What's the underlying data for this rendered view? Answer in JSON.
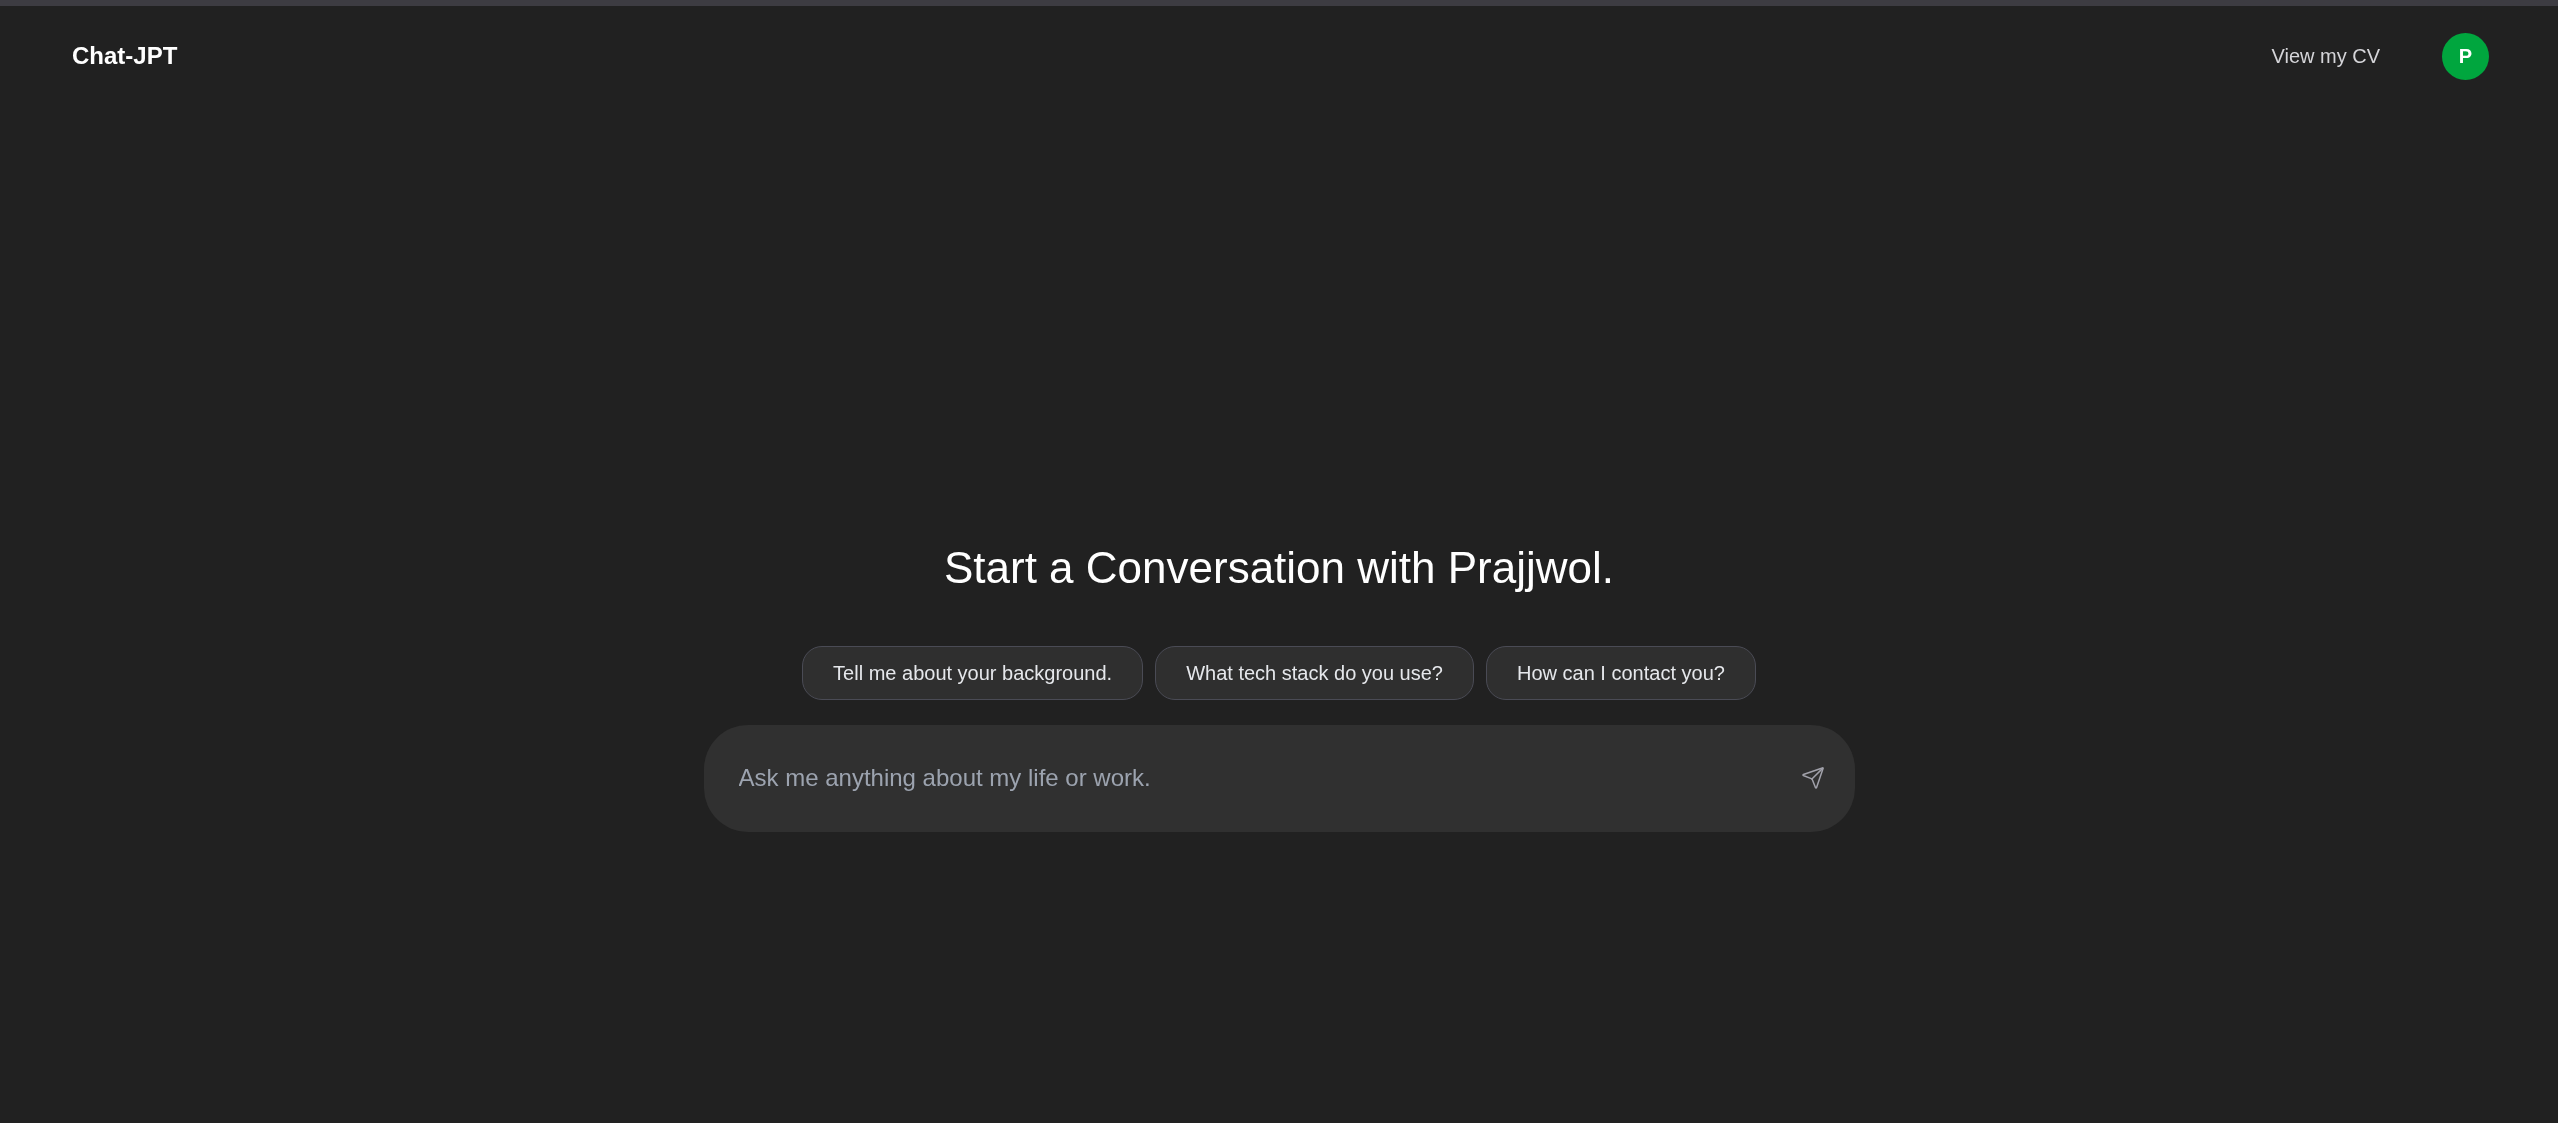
{
  "header": {
    "title": "Chat-JPT",
    "cv_link": "View my CV",
    "avatar_initial": "P"
  },
  "main": {
    "heading": "Start a Conversation with Prajjwol.",
    "suggestions": [
      "Tell me about your background.",
      "What tech stack do you use?",
      "How can I contact you?"
    ],
    "input": {
      "placeholder": "Ask me anything about my life or work."
    }
  }
}
